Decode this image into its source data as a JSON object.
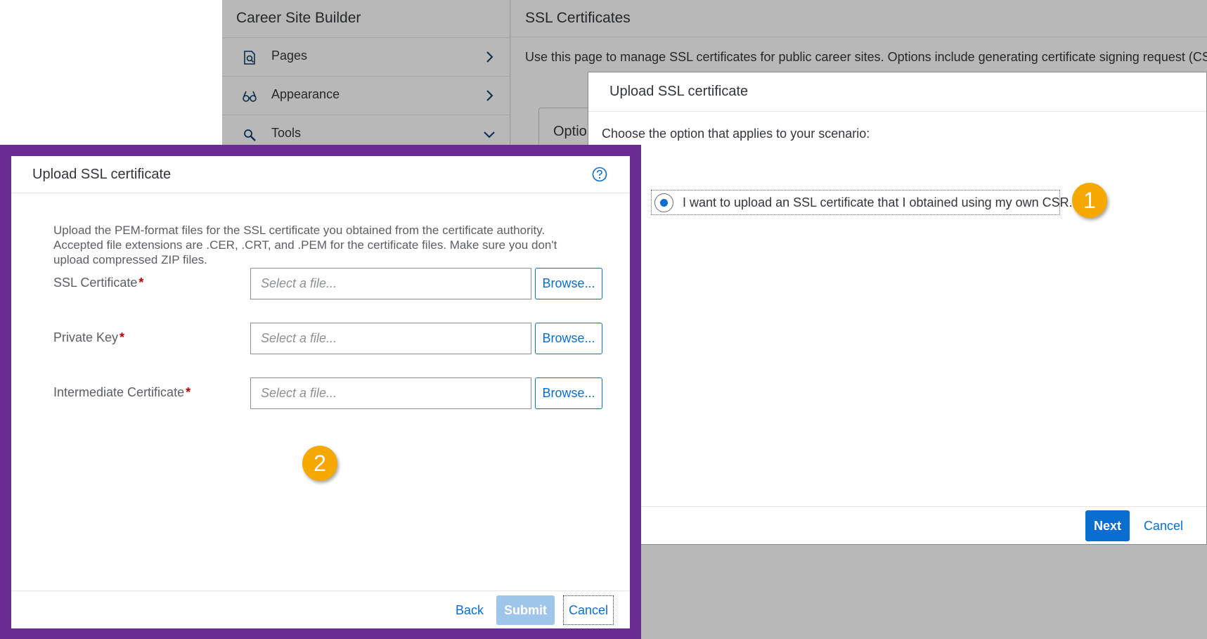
{
  "background": {
    "nav": {
      "title": "Career Site Builder",
      "items": [
        {
          "label": "Pages",
          "icon": "page-search-icon",
          "chevron": "chevron-right-icon"
        },
        {
          "label": "Appearance",
          "icon": "glasses-icon",
          "chevron": "chevron-right-icon"
        },
        {
          "label": "Tools",
          "icon": "tools-icon",
          "chevron": "chevron-down-icon"
        }
      ]
    },
    "main": {
      "title": "SSL Certificates",
      "description": "Use this page to manage SSL certificates for public career sites. Options include generating certificate signing request (CSR) files as well as installing, renewing, and uninstalling certificates.",
      "options_card": "Optio"
    }
  },
  "dialog1": {
    "title": "Upload SSL certificate",
    "prompt": "Choose the option that applies to your scenario:",
    "option_label": "I want to upload an SSL certificate that I obtained using my own CSR.",
    "option_selected": true,
    "next_label": "Next",
    "cancel_label": "Cancel"
  },
  "dialog2": {
    "title": "Upload SSL certificate",
    "help_icon": "help-circle-icon",
    "description": "Upload the PEM-format files for the SSL certificate you obtained from the certificate authority. Accepted file extensions are .CER, .CRT, and .PEM for the certificate files. Make sure you don't upload compressed ZIP files.",
    "fields": [
      {
        "label": "SSL Certificate",
        "required": "*",
        "placeholder": "Select a file...",
        "value": "",
        "browse_label": "Browse..."
      },
      {
        "label": "Private Key",
        "required": "*",
        "placeholder": "Select a file...",
        "value": "",
        "browse_label": "Browse..."
      },
      {
        "label": "Intermediate Certificate",
        "required": "*",
        "placeholder": "Select a file...",
        "value": "",
        "browse_label": "Browse..."
      }
    ],
    "back_label": "Back",
    "submit_label": "Submit",
    "cancel_label": "Cancel"
  },
  "badges": {
    "one": "1",
    "two": "2"
  },
  "colors": {
    "accent": "#0a6ed1",
    "callout": "#f4a800",
    "frame": "#6a2b92",
    "required": "#bb0000",
    "submit_disabled": "#9fc5eb"
  }
}
